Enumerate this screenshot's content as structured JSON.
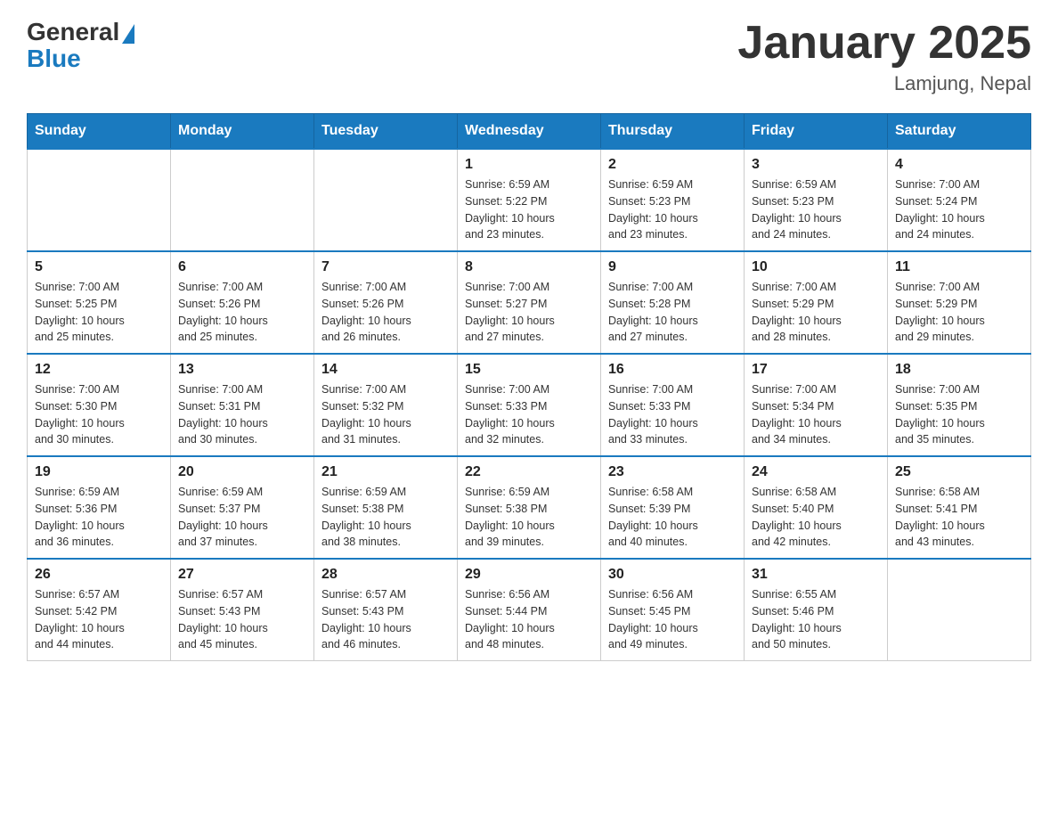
{
  "header": {
    "logo_general": "General",
    "logo_blue": "Blue",
    "month_title": "January 2025",
    "location": "Lamjung, Nepal"
  },
  "days_of_week": [
    "Sunday",
    "Monday",
    "Tuesday",
    "Wednesday",
    "Thursday",
    "Friday",
    "Saturday"
  ],
  "weeks": [
    [
      {
        "day": "",
        "info": ""
      },
      {
        "day": "",
        "info": ""
      },
      {
        "day": "",
        "info": ""
      },
      {
        "day": "1",
        "info": "Sunrise: 6:59 AM\nSunset: 5:22 PM\nDaylight: 10 hours\nand 23 minutes."
      },
      {
        "day": "2",
        "info": "Sunrise: 6:59 AM\nSunset: 5:23 PM\nDaylight: 10 hours\nand 23 minutes."
      },
      {
        "day": "3",
        "info": "Sunrise: 6:59 AM\nSunset: 5:23 PM\nDaylight: 10 hours\nand 24 minutes."
      },
      {
        "day": "4",
        "info": "Sunrise: 7:00 AM\nSunset: 5:24 PM\nDaylight: 10 hours\nand 24 minutes."
      }
    ],
    [
      {
        "day": "5",
        "info": "Sunrise: 7:00 AM\nSunset: 5:25 PM\nDaylight: 10 hours\nand 25 minutes."
      },
      {
        "day": "6",
        "info": "Sunrise: 7:00 AM\nSunset: 5:26 PM\nDaylight: 10 hours\nand 25 minutes."
      },
      {
        "day": "7",
        "info": "Sunrise: 7:00 AM\nSunset: 5:26 PM\nDaylight: 10 hours\nand 26 minutes."
      },
      {
        "day": "8",
        "info": "Sunrise: 7:00 AM\nSunset: 5:27 PM\nDaylight: 10 hours\nand 27 minutes."
      },
      {
        "day": "9",
        "info": "Sunrise: 7:00 AM\nSunset: 5:28 PM\nDaylight: 10 hours\nand 27 minutes."
      },
      {
        "day": "10",
        "info": "Sunrise: 7:00 AM\nSunset: 5:29 PM\nDaylight: 10 hours\nand 28 minutes."
      },
      {
        "day": "11",
        "info": "Sunrise: 7:00 AM\nSunset: 5:29 PM\nDaylight: 10 hours\nand 29 minutes."
      }
    ],
    [
      {
        "day": "12",
        "info": "Sunrise: 7:00 AM\nSunset: 5:30 PM\nDaylight: 10 hours\nand 30 minutes."
      },
      {
        "day": "13",
        "info": "Sunrise: 7:00 AM\nSunset: 5:31 PM\nDaylight: 10 hours\nand 30 minutes."
      },
      {
        "day": "14",
        "info": "Sunrise: 7:00 AM\nSunset: 5:32 PM\nDaylight: 10 hours\nand 31 minutes."
      },
      {
        "day": "15",
        "info": "Sunrise: 7:00 AM\nSunset: 5:33 PM\nDaylight: 10 hours\nand 32 minutes."
      },
      {
        "day": "16",
        "info": "Sunrise: 7:00 AM\nSunset: 5:33 PM\nDaylight: 10 hours\nand 33 minutes."
      },
      {
        "day": "17",
        "info": "Sunrise: 7:00 AM\nSunset: 5:34 PM\nDaylight: 10 hours\nand 34 minutes."
      },
      {
        "day": "18",
        "info": "Sunrise: 7:00 AM\nSunset: 5:35 PM\nDaylight: 10 hours\nand 35 minutes."
      }
    ],
    [
      {
        "day": "19",
        "info": "Sunrise: 6:59 AM\nSunset: 5:36 PM\nDaylight: 10 hours\nand 36 minutes."
      },
      {
        "day": "20",
        "info": "Sunrise: 6:59 AM\nSunset: 5:37 PM\nDaylight: 10 hours\nand 37 minutes."
      },
      {
        "day": "21",
        "info": "Sunrise: 6:59 AM\nSunset: 5:38 PM\nDaylight: 10 hours\nand 38 minutes."
      },
      {
        "day": "22",
        "info": "Sunrise: 6:59 AM\nSunset: 5:38 PM\nDaylight: 10 hours\nand 39 minutes."
      },
      {
        "day": "23",
        "info": "Sunrise: 6:58 AM\nSunset: 5:39 PM\nDaylight: 10 hours\nand 40 minutes."
      },
      {
        "day": "24",
        "info": "Sunrise: 6:58 AM\nSunset: 5:40 PM\nDaylight: 10 hours\nand 42 minutes."
      },
      {
        "day": "25",
        "info": "Sunrise: 6:58 AM\nSunset: 5:41 PM\nDaylight: 10 hours\nand 43 minutes."
      }
    ],
    [
      {
        "day": "26",
        "info": "Sunrise: 6:57 AM\nSunset: 5:42 PM\nDaylight: 10 hours\nand 44 minutes."
      },
      {
        "day": "27",
        "info": "Sunrise: 6:57 AM\nSunset: 5:43 PM\nDaylight: 10 hours\nand 45 minutes."
      },
      {
        "day": "28",
        "info": "Sunrise: 6:57 AM\nSunset: 5:43 PM\nDaylight: 10 hours\nand 46 minutes."
      },
      {
        "day": "29",
        "info": "Sunrise: 6:56 AM\nSunset: 5:44 PM\nDaylight: 10 hours\nand 48 minutes."
      },
      {
        "day": "30",
        "info": "Sunrise: 6:56 AM\nSunset: 5:45 PM\nDaylight: 10 hours\nand 49 minutes."
      },
      {
        "day": "31",
        "info": "Sunrise: 6:55 AM\nSunset: 5:46 PM\nDaylight: 10 hours\nand 50 minutes."
      },
      {
        "day": "",
        "info": ""
      }
    ]
  ]
}
